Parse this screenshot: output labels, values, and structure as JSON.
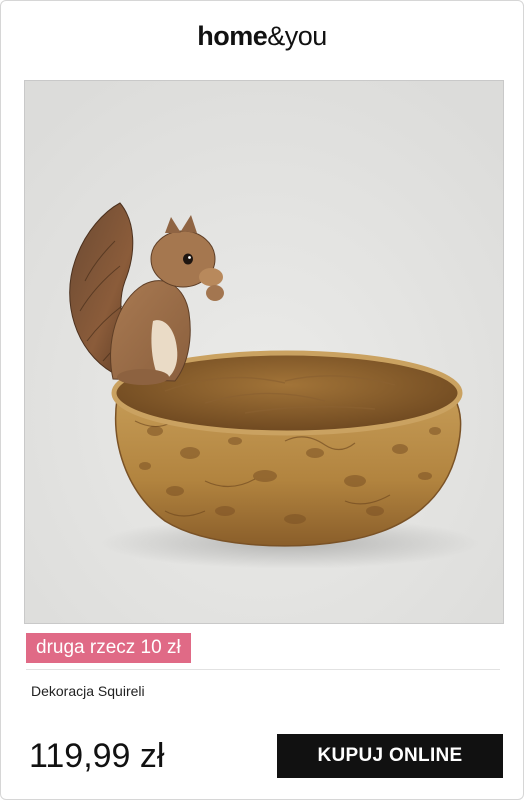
{
  "brand": {
    "part1": "home",
    "part2": "&",
    "part3": "you"
  },
  "product": {
    "image_subject": "squirrel-nut-bowl",
    "promo_label": "druga rzecz 10 zł",
    "name": "Dekoracja Squireli",
    "price": "119,99 zł",
    "cta_label": "KUPUJ ONLINE"
  },
  "colors": {
    "promo_bg": "#e06a86",
    "button_bg": "#111111",
    "image_bg": "#e6e6e4"
  }
}
